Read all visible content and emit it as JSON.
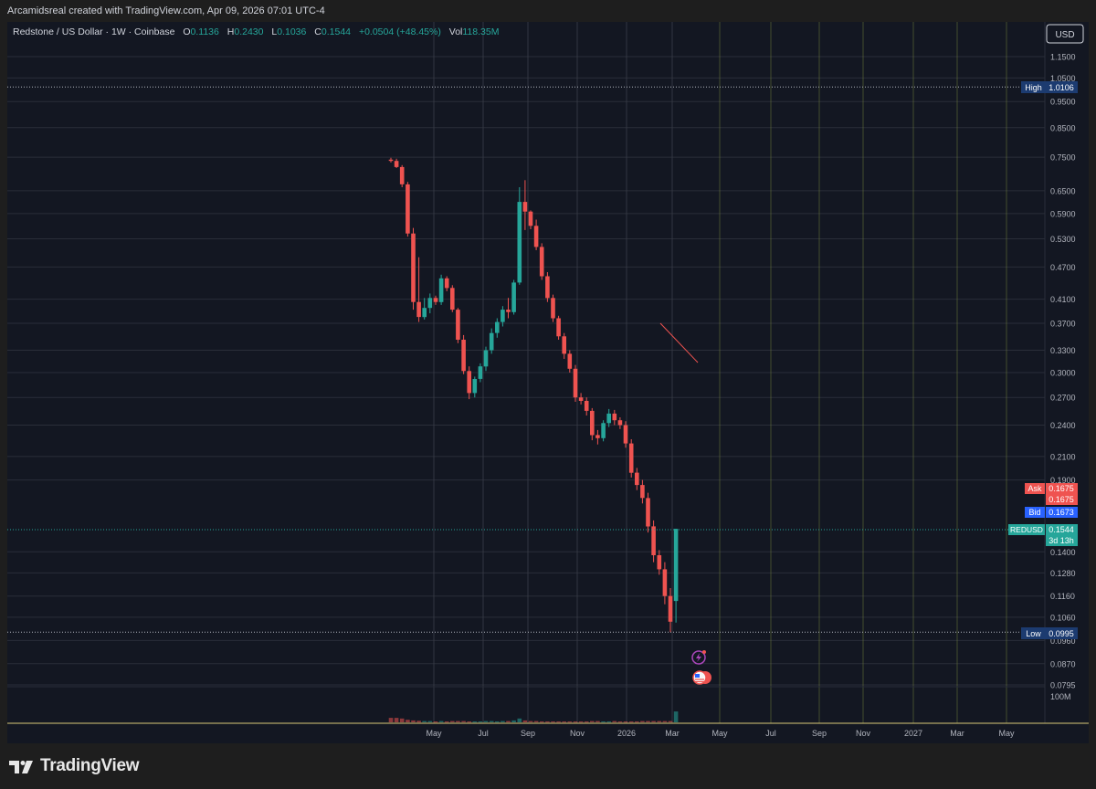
{
  "header": {
    "caption": "Arcamidsreal created with TradingView.com, Apr 09, 2026 07:01 UTC-4"
  },
  "legend": {
    "symbol": "Redstone / US Dollar · 1W · Coinbase",
    "o_label": "O",
    "o_value": "0.1136",
    "h_label": "H",
    "h_value": "0.2430",
    "l_label": "L",
    "l_value": "0.1036",
    "c_label": "C",
    "c_value": "0.1544",
    "change": "+0.0504 (+48.45%)",
    "vol_label": "Vol",
    "vol_value": "118.35M"
  },
  "currency_button": "USD",
  "price_tags": {
    "high_label": "High",
    "high_value": "1.0106",
    "low_label": "Low",
    "low_value": "0.0995",
    "ask_label": "Ask",
    "ask_value": "0.1675",
    "ask_value2": "0.1675",
    "bid_label": "Bid",
    "bid_value": "0.1673",
    "symbol_label": "REDUSD",
    "last_value": "0.1544",
    "countdown": "3d 13h"
  },
  "volume_axis_label": "100M",
  "footer": {
    "brand": "TradingView"
  },
  "colors": {
    "up": "#26a69a",
    "down": "#ef5350",
    "background": "#131722",
    "grid": "#2a2e39",
    "axis_text": "#b2b5be",
    "high_low_tag": "#1c3b70",
    "bid_tag": "#2962ff",
    "extended_grid": "#6b7a3a"
  },
  "chart_data": {
    "type": "candlestick",
    "timeframe": "1W",
    "scale": "log",
    "y_ticks": [
      1.15,
      1.05,
      0.95,
      0.85,
      0.75,
      0.65,
      0.59,
      0.53,
      0.47,
      0.41,
      0.37,
      0.33,
      0.3,
      0.27,
      0.24,
      0.21,
      0.19,
      0.14,
      0.128,
      0.116,
      0.106,
      0.096,
      0.087,
      0.0795
    ],
    "x_ticks": [
      "May",
      "Jul",
      "Sep",
      "Nov",
      "2026",
      "Mar",
      "May",
      "Jul",
      "Sep",
      "Nov",
      "2027",
      "Mar",
      "May"
    ],
    "high": 1.0106,
    "low": 0.0995,
    "last": 0.1544,
    "candles": [
      {
        "o": 0.742,
        "h": 0.748,
        "l": 0.733,
        "c": 0.738
      },
      {
        "o": 0.738,
        "h": 0.745,
        "l": 0.716,
        "c": 0.719
      },
      {
        "o": 0.719,
        "h": 0.725,
        "l": 0.66,
        "c": 0.668
      },
      {
        "o": 0.668,
        "h": 0.675,
        "l": 0.535,
        "c": 0.542
      },
      {
        "o": 0.542,
        "h": 0.555,
        "l": 0.392,
        "c": 0.405
      },
      {
        "o": 0.405,
        "h": 0.49,
        "l": 0.372,
        "c": 0.38
      },
      {
        "o": 0.38,
        "h": 0.412,
        "l": 0.376,
        "c": 0.395
      },
      {
        "o": 0.395,
        "h": 0.42,
        "l": 0.386,
        "c": 0.412
      },
      {
        "o": 0.412,
        "h": 0.416,
        "l": 0.4,
        "c": 0.405
      },
      {
        "o": 0.405,
        "h": 0.455,
        "l": 0.4,
        "c": 0.448
      },
      {
        "o": 0.448,
        "h": 0.452,
        "l": 0.424,
        "c": 0.43
      },
      {
        "o": 0.43,
        "h": 0.435,
        "l": 0.388,
        "c": 0.392
      },
      {
        "o": 0.392,
        "h": 0.395,
        "l": 0.34,
        "c": 0.345
      },
      {
        "o": 0.345,
        "h": 0.352,
        "l": 0.298,
        "c": 0.302
      },
      {
        "o": 0.302,
        "h": 0.308,
        "l": 0.268,
        "c": 0.275
      },
      {
        "o": 0.275,
        "h": 0.295,
        "l": 0.27,
        "c": 0.292
      },
      {
        "o": 0.292,
        "h": 0.312,
        "l": 0.288,
        "c": 0.308
      },
      {
        "o": 0.308,
        "h": 0.335,
        "l": 0.302,
        "c": 0.33
      },
      {
        "o": 0.33,
        "h": 0.362,
        "l": 0.325,
        "c": 0.355
      },
      {
        "o": 0.355,
        "h": 0.378,
        "l": 0.348,
        "c": 0.372
      },
      {
        "o": 0.372,
        "h": 0.398,
        "l": 0.365,
        "c": 0.392
      },
      {
        "o": 0.392,
        "h": 0.412,
        "l": 0.378,
        "c": 0.388
      },
      {
        "o": 0.388,
        "h": 0.445,
        "l": 0.384,
        "c": 0.44
      },
      {
        "o": 0.44,
        "h": 0.66,
        "l": 0.436,
        "c": 0.62
      },
      {
        "o": 0.62,
        "h": 0.68,
        "l": 0.55,
        "c": 0.595
      },
      {
        "o": 0.595,
        "h": 0.598,
        "l": 0.552,
        "c": 0.56
      },
      {
        "o": 0.56,
        "h": 0.575,
        "l": 0.505,
        "c": 0.512
      },
      {
        "o": 0.512,
        "h": 0.52,
        "l": 0.445,
        "c": 0.452
      },
      {
        "o": 0.452,
        "h": 0.46,
        "l": 0.405,
        "c": 0.412
      },
      {
        "o": 0.412,
        "h": 0.418,
        "l": 0.372,
        "c": 0.378
      },
      {
        "o": 0.378,
        "h": 0.382,
        "l": 0.345,
        "c": 0.35
      },
      {
        "o": 0.35,
        "h": 0.355,
        "l": 0.318,
        "c": 0.325
      },
      {
        "o": 0.325,
        "h": 0.33,
        "l": 0.3,
        "c": 0.305
      },
      {
        "o": 0.305,
        "h": 0.31,
        "l": 0.265,
        "c": 0.27
      },
      {
        "o": 0.27,
        "h": 0.275,
        "l": 0.262,
        "c": 0.266
      },
      {
        "o": 0.266,
        "h": 0.27,
        "l": 0.25,
        "c": 0.255
      },
      {
        "o": 0.255,
        "h": 0.258,
        "l": 0.225,
        "c": 0.23
      },
      {
        "o": 0.23,
        "h": 0.235,
        "l": 0.221,
        "c": 0.227
      },
      {
        "o": 0.227,
        "h": 0.245,
        "l": 0.224,
        "c": 0.242
      },
      {
        "o": 0.242,
        "h": 0.257,
        "l": 0.238,
        "c": 0.252
      },
      {
        "o": 0.252,
        "h": 0.256,
        "l": 0.24,
        "c": 0.245
      },
      {
        "o": 0.245,
        "h": 0.248,
        "l": 0.236,
        "c": 0.24
      },
      {
        "o": 0.24,
        "h": 0.244,
        "l": 0.218,
        "c": 0.222
      },
      {
        "o": 0.222,
        "h": 0.226,
        "l": 0.192,
        "c": 0.196
      },
      {
        "o": 0.196,
        "h": 0.2,
        "l": 0.182,
        "c": 0.186
      },
      {
        "o": 0.186,
        "h": 0.19,
        "l": 0.172,
        "c": 0.176
      },
      {
        "o": 0.176,
        "h": 0.18,
        "l": 0.152,
        "c": 0.156
      },
      {
        "o": 0.156,
        "h": 0.16,
        "l": 0.134,
        "c": 0.138
      },
      {
        "o": 0.138,
        "h": 0.141,
        "l": 0.127,
        "c": 0.13
      },
      {
        "o": 0.13,
        "h": 0.134,
        "l": 0.112,
        "c": 0.116
      },
      {
        "o": 0.116,
        "h": 0.12,
        "l": 0.0995,
        "c": 0.104
      },
      {
        "o": 0.1136,
        "h": 0.1544,
        "l": 0.1036,
        "c": 0.1544
      }
    ],
    "volume_max": 100,
    "volume": [
      14,
      14,
      12,
      8,
      6,
      5,
      4,
      4,
      3,
      4,
      3,
      4,
      4,
      4,
      3,
      3,
      3,
      4,
      4,
      3,
      4,
      4,
      6,
      12,
      6,
      4,
      4,
      3,
      3,
      3,
      3,
      3,
      3,
      3,
      3,
      3,
      4,
      4,
      3,
      3,
      4,
      3,
      3,
      3,
      3,
      4,
      4,
      4,
      4,
      4,
      4,
      34
    ]
  }
}
